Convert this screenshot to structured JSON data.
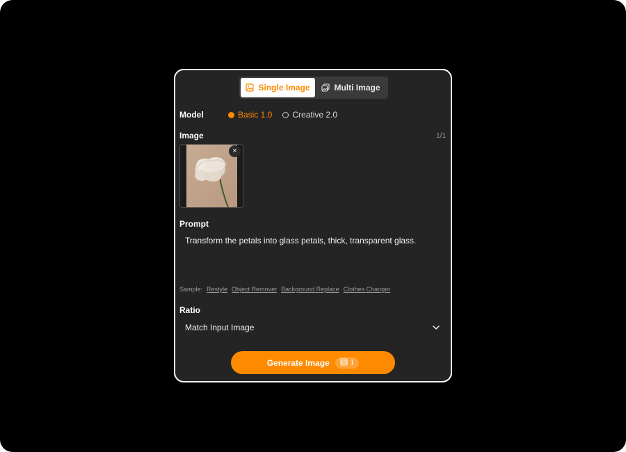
{
  "tabs": {
    "single_label": "Single Image",
    "multi_label": "Multi Image",
    "active": "Single Image"
  },
  "model": {
    "label": "Model",
    "options": [
      {
        "label": "Basic 1.0",
        "selected": true
      },
      {
        "label": "Creative 2.0",
        "selected": false
      }
    ]
  },
  "image": {
    "label": "Image",
    "counter": "1/1",
    "close_glyph": "×"
  },
  "prompt": {
    "label": "Prompt",
    "value": "Transform the petals into glass petals, thick, transparent glass.",
    "sample_label": "Sample:",
    "samples": [
      "Restyle",
      "Object Remover",
      "Background Replace",
      "Clothes Changer"
    ]
  },
  "ratio": {
    "label": "Ratio",
    "value": "Match Input Image"
  },
  "generate": {
    "label": "Generate Image",
    "credits": "1"
  },
  "colors": {
    "accent": "#ff8a00",
    "panel": "#242424",
    "background": "#000000"
  },
  "icons": {
    "single_tab": "image-icon",
    "multi_tab": "images-stack-icon",
    "dropdown": "chevron-down-icon",
    "credits": "coin-stack-icon",
    "remove": "close-icon"
  }
}
